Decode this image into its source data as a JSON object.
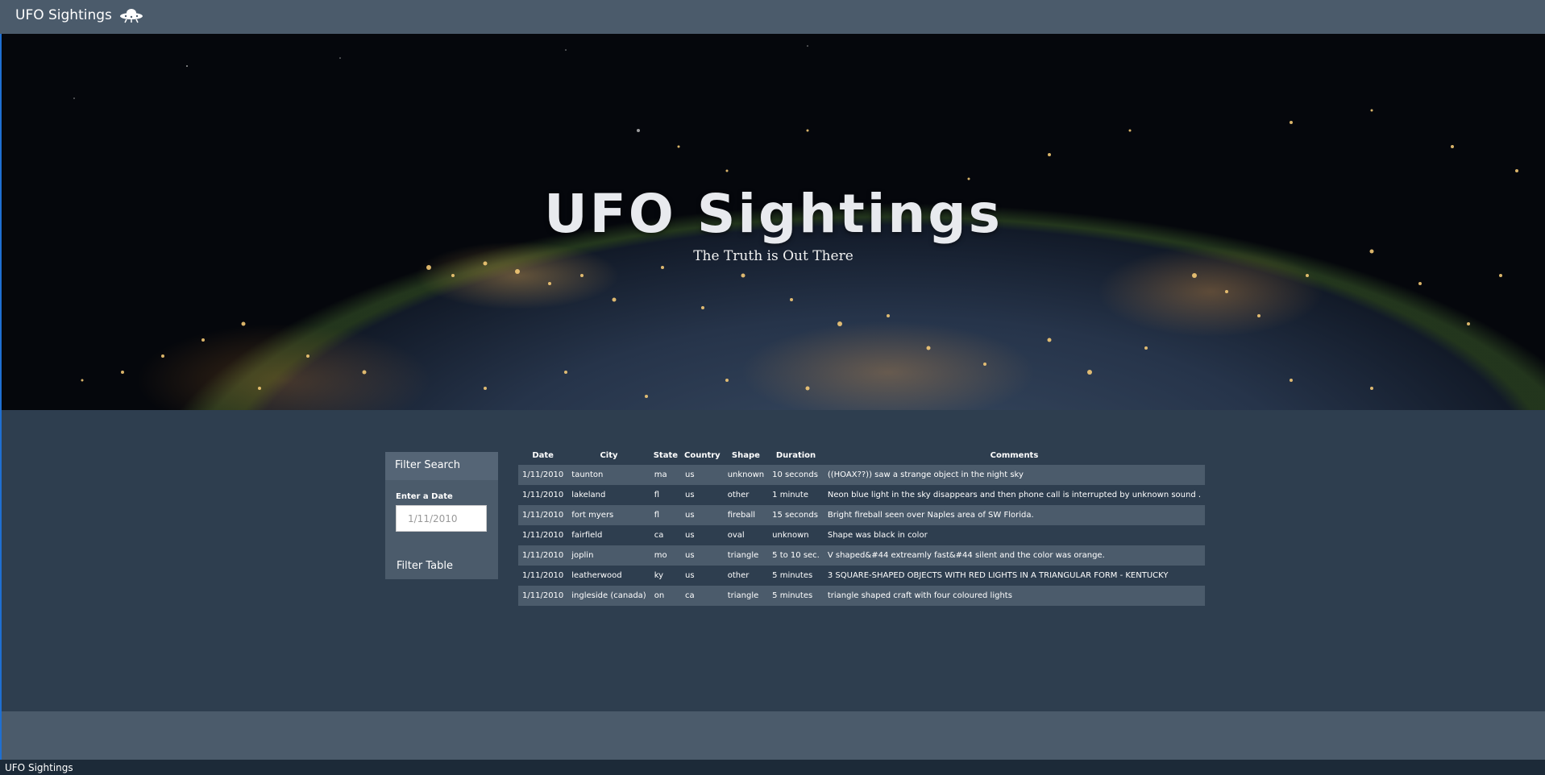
{
  "navbar": {
    "brand": "UFO Sightings",
    "icon": "ufo-icon"
  },
  "hero": {
    "title": "UFO Sightings",
    "subtitle": "The Truth is Out There"
  },
  "filter": {
    "heading": "Filter Search",
    "label": "Enter a Date",
    "placeholder": "1/11/2010",
    "button": "Filter Table"
  },
  "table": {
    "headers": [
      "Date",
      "City",
      "State",
      "Country",
      "Shape",
      "Duration",
      "Comments"
    ],
    "rows": [
      [
        "1/11/2010",
        "taunton",
        "ma",
        "us",
        "unknown",
        "10 seconds",
        "((HOAX??)) saw a strange object in the night sky"
      ],
      [
        "1/11/2010",
        "lakeland",
        "fl",
        "us",
        "other",
        "1 minute",
        "Neon blue light in the sky disappears and then phone call is interrupted by unknown sound ."
      ],
      [
        "1/11/2010",
        "fort myers",
        "fl",
        "us",
        "fireball",
        "15 seconds",
        "Bright fireball seen over Naples area of SW Florida."
      ],
      [
        "1/11/2010",
        "fairfield",
        "ca",
        "us",
        "oval",
        "unknown",
        "Shape was black in color"
      ],
      [
        "1/11/2010",
        "joplin",
        "mo",
        "us",
        "triangle",
        "5 to 10 sec.",
        "V shaped&#44 extreamly fast&#44 silent and the color was orange."
      ],
      [
        "1/11/2010",
        "leatherwood",
        "ky",
        "us",
        "other",
        "5 minutes",
        "3 SQUARE-SHAPED OBJECTS WITH RED LIGHTS IN A TRIANGULAR FORM - KENTUCKY"
      ],
      [
        "1/11/2010",
        "ingleside (canada)",
        "on",
        "ca",
        "triangle",
        "5 minutes",
        "triangle shaped craft with four coloured lights"
      ]
    ]
  },
  "footer": {
    "text": "UFO Sightings"
  }
}
